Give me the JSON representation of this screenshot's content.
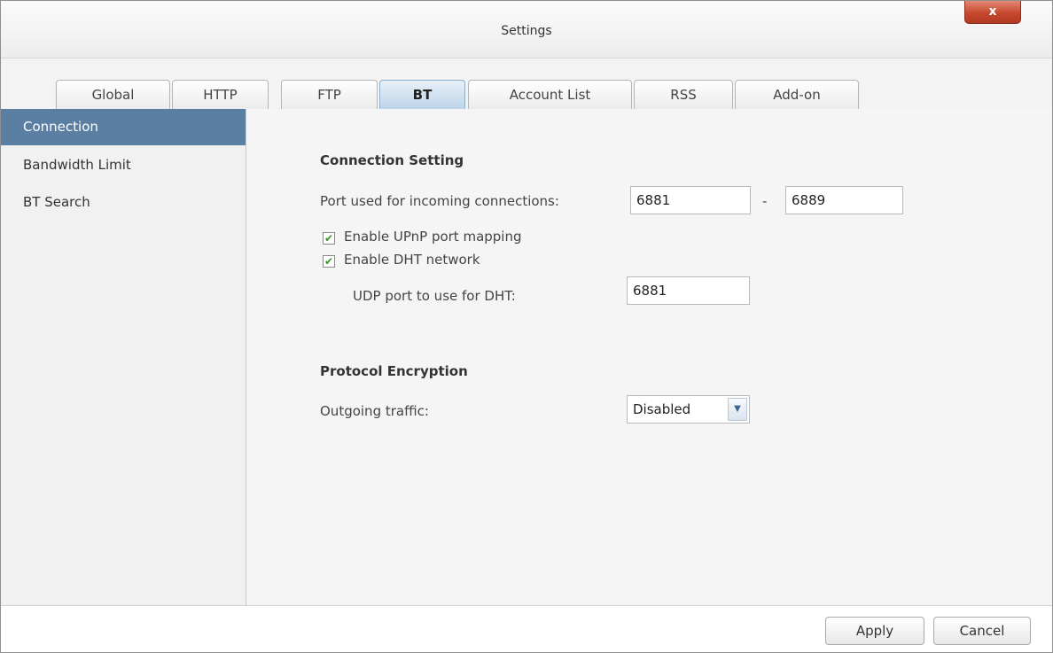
{
  "window": {
    "title": "Settings",
    "close_label": "x"
  },
  "tabs": [
    {
      "label": "Global",
      "active": false
    },
    {
      "label": "HTTP",
      "active": false
    },
    {
      "label": "FTP",
      "active": false
    },
    {
      "label": "BT",
      "active": true
    },
    {
      "label": "Account List",
      "active": false
    },
    {
      "label": "RSS",
      "active": false
    },
    {
      "label": "Add-on",
      "active": false
    }
  ],
  "sidebar": {
    "items": [
      {
        "label": "Connection",
        "active": true
      },
      {
        "label": "Bandwidth Limit",
        "active": false
      },
      {
        "label": "BT Search",
        "active": false
      }
    ]
  },
  "connection_setting": {
    "title": "Connection Setting",
    "port_label": "Port used for incoming connections:",
    "port_from": "6881",
    "port_separator": "-",
    "port_to": "6889",
    "upnp_label": "Enable UPnP port mapping",
    "upnp_checked": true,
    "dht_label": "Enable DHT network",
    "dht_checked": true,
    "udp_label": "UDP port to use for DHT:",
    "udp_port": "6881",
    "check_glyph": "✔"
  },
  "protocol_encryption": {
    "title": "Protocol Encryption",
    "outgoing_label": "Outgoing traffic:",
    "outgoing_value": "Disabled",
    "arrow_glyph": "▼"
  },
  "footer": {
    "apply_label": "Apply",
    "cancel_label": "Cancel"
  },
  "colors": {
    "sidebar_active": "#5b7fa3",
    "close_button": "#c6482f",
    "check": "#3c8f2c"
  }
}
